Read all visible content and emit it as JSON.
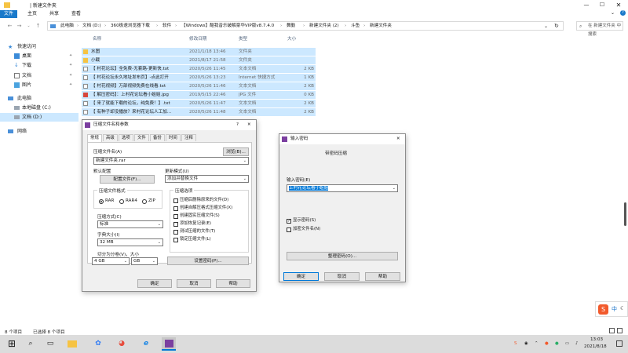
{
  "title_bar": {
    "path_label": "| 新建文件夹"
  },
  "ribbon": {
    "tabs": [
      "文件",
      "主页",
      "共享",
      "查看"
    ]
  },
  "address": {
    "crumbs": [
      "此电脑",
      "文档 (D:)",
      "360极速浏览器下载",
      "软件",
      "【Windows】酷我音乐破解豪华VIP版v8.7.4.0",
      "舞勤",
      "新建文件夹 (2)",
      "斗鱼",
      "新建文件夹"
    ],
    "search_placeholder": "在 新建文件夹 中搜索"
  },
  "nav": {
    "quick_access": "快速访问",
    "items": [
      "桌面",
      "下载",
      "文档",
      "图片"
    ],
    "this_pc": "此电脑",
    "drives": [
      "本地磁盘 (C:)",
      "文档 (D:)"
    ],
    "network": "网络"
  },
  "columns": {
    "name": "名称",
    "date": "修改日期",
    "type": "类型",
    "size": "大小"
  },
  "files": [
    {
      "name": "水图",
      "date": "2021/1/18 13:46",
      "type": "文件夹",
      "size": "",
      "icon": "folder"
    },
    {
      "name": "小截",
      "date": "2021/8/17 21:58",
      "type": "文件夹",
      "size": "",
      "icon": "folder"
    },
    {
      "name": "【 村花论坛】全免费-无套路-更新快.txt",
      "date": "2020/5/26 11:45",
      "type": "文本文档",
      "size": "2 KB",
      "icon": "doc"
    },
    {
      "name": "【 村花论坛永久地址发布页】-点此打开",
      "date": "2020/5/26 13:23",
      "type": "Internet 快捷方式",
      "size": "1 KB",
      "icon": "doc"
    },
    {
      "name": "【 村花视频】万部视频免费在线看.txt",
      "date": "2020/5/26 11:46",
      "type": "文本文档",
      "size": "2 KB",
      "icon": "doc"
    },
    {
      "name": "【 解压密码】：上村花论坛看小姐姐.jpg",
      "date": "2019/5/15 22:46",
      "type": "JPG 文件",
      "size": "0 KB",
      "icon": "img"
    },
    {
      "name": "【 来了就能下载的论坛，纯免费！】.txt",
      "date": "2020/5/26 11:47",
      "type": "文本文档",
      "size": "2 KB",
      "icon": "doc"
    },
    {
      "name": "【 有种子却没播放？来村花论坛人工加...",
      "date": "2020/5/26 11:48",
      "type": "文本文档",
      "size": "2 KB",
      "icon": "doc"
    }
  ],
  "status": {
    "count": "8 个项目",
    "selected": "已选择 8 个项目"
  },
  "archive_dialog": {
    "title": "压缩文件名和参数",
    "tabs": [
      "常规",
      "高级",
      "选项",
      "文件",
      "备份",
      "时间",
      "注释"
    ],
    "name_label": "压缩文件名(A)",
    "browse_button": "浏览(B)...",
    "name_value": "新建文件夹.rar",
    "profile_label": "默认配置",
    "profile_button": "配置文件(F)...",
    "update_label": "更新模式(U)",
    "update_value": "添加并替换文件",
    "format_label": "压缩文件格式",
    "formats": [
      "RAR",
      "RAR4",
      "ZIP"
    ],
    "method_label": "压缩方式(C)",
    "method_value": "标准",
    "dict_label": "字典大小(I)",
    "dict_value": "32 MB",
    "split_label": "切分为分卷(V)，大小",
    "split_value": "4 GB",
    "split_unit": "GB",
    "options_label": "压缩选项",
    "options": [
      "压缩后删除原来的文件(D)",
      "创建自解压格式压缩文件(X)",
      "创建固实压缩文件(S)",
      "添加恢复记录(E)",
      "测试压缩的文件(T)",
      "锁定压缩文件(L)"
    ],
    "password_button": "设置密码(P)...",
    "ok": "确定",
    "cancel": "取消",
    "help": "帮助"
  },
  "password_dialog": {
    "title": "输入密码",
    "subtitle": "带密码压缩",
    "input_label": "输入密码(E)",
    "input_value": "上村花论坛看小姐姐",
    "show_password": "显示密码(S)",
    "encrypt_names": "加密文件名(N)",
    "organize_button": "整理密码(O)...",
    "ok": "确定",
    "cancel": "取消",
    "help": "帮助"
  },
  "taskbar": {
    "time": "13:03",
    "date": "2021/8/18",
    "ime": "中"
  },
  "colors": {
    "selection": "#cce8ff",
    "accent": "#0078d7",
    "taskbar": "#dcdcdc"
  }
}
